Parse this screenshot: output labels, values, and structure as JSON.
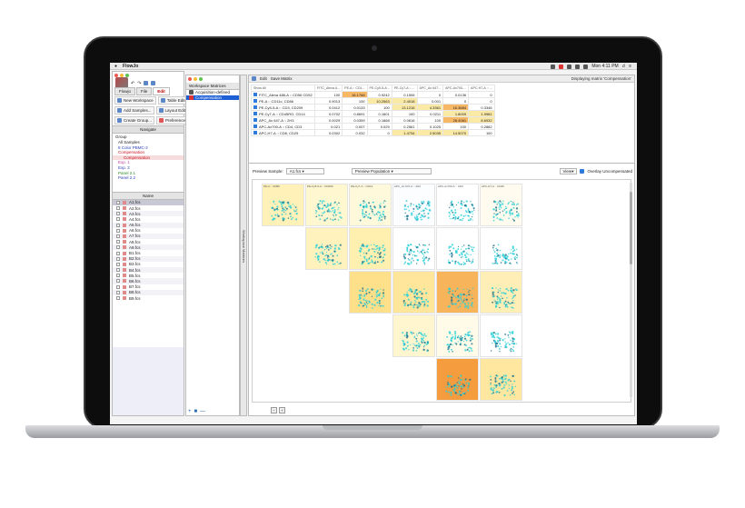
{
  "menubar": {
    "app_name": "FlowJo",
    "clock": "Mon 4:11 PM"
  },
  "left_panel": {
    "tabs": [
      "Flowjo",
      "File",
      "Edit"
    ],
    "buttons": [
      "New Workspace",
      "Table Editor",
      "Add Samples...",
      "Layout Editor",
      "Create Group...",
      "Preferences"
    ],
    "navigate_label": "Navigate",
    "group_header": "Group",
    "groups": [
      {
        "label": "All Samples",
        "style": "normal"
      },
      {
        "label": "8 Color PBMC-2",
        "style": "blue"
      },
      {
        "label": "Compensation",
        "style": "red"
      },
      {
        "label": "Compensation",
        "style": "red-sel"
      },
      {
        "label": "Exp. 1",
        "style": "pink"
      },
      {
        "label": "Exp. 2",
        "style": "blue"
      },
      {
        "label": "Panel 2.1",
        "style": "green"
      },
      {
        "label": "Panel 2.2",
        "style": "blue"
      }
    ],
    "name_header": "Name",
    "samples": [
      "A1.fcs",
      "A2.fcs",
      "A3.fcs",
      "A4.fcs",
      "A5.fcs",
      "A6.fcs",
      "A7.fcs",
      "A8.fcs",
      "A9.fcs",
      "B1.fcs",
      "B2.fcs",
      "B3.fcs",
      "B4.fcs",
      "B5.fcs",
      "B6.fcs",
      "B7.fcs",
      "B8.fcs",
      "B9.fcs"
    ]
  },
  "middle_panel": {
    "title": "Workspace Matrices",
    "items": [
      "Acquisition-defined",
      "Compensation"
    ],
    "vertical_label": "Workspace Matrices"
  },
  "matrix_window": {
    "edit_label": "Edit",
    "save_label": "Save Matrix",
    "displaying": "Displaying matrix 'Compensation'",
    "show_all": "Show All",
    "columns": [
      "FITC_Alexa A...",
      "PE-A :: CD1...",
      "PE-Cy5-5-A...",
      "PE-Cy7-A :: ...",
      "APC_Ax 647...",
      "APC-Ax700-...",
      "APC-H7-A :: ..."
    ],
    "rows": [
      {
        "label": "FITC_Alexa 488-A :: CD56 CD52",
        "values": [
          "100",
          "16.1766",
          "0.9242",
          "0.1506",
          "0",
          "0.0136",
          "0"
        ]
      },
      {
        "label": "PE-A :: CD11c, CD86",
        "values": [
          "0.9013",
          "100",
          "10.2563",
          "2.4018",
          "0.001",
          "0",
          "0"
        ]
      },
      {
        "label": "PE-Cy5-5-A :: CD3, CD209",
        "values": [
          "0.0412",
          "0.0133",
          "100",
          "13.1216",
          "4.3361",
          "16.3684",
          "0.3346"
        ]
      },
      {
        "label": "PE-Cy7-A :: CD45RO, CD14",
        "values": [
          "0.0702",
          "0.8691",
          "0.1601",
          "100",
          "0.0211",
          "1.8009",
          "1.9981"
        ]
      },
      {
        "label": "APC_Ax 647-A :: 2H3",
        "values": [
          "0.0029",
          "0.0359",
          "0.1868",
          "0.0616",
          "100",
          "28.4081",
          "8.6932"
        ]
      },
      {
        "label": "APC-Ax700-A :: CD4, CD3",
        "values": [
          "0.021",
          "0.007",
          "0.029",
          "0.2561",
          "0.1025",
          "100",
          "0.2882"
        ]
      },
      {
        "label": "APC-H7-A :: CD8, CD25",
        "values": [
          "0.0302",
          "0.032",
          "0",
          "1.4734",
          "2.5035",
          "14.5070",
          "100"
        ]
      }
    ],
    "preview_sample_label": "Preview Sample:",
    "preview_sample_value": "A1.fcs",
    "preview_population_value": "Preview Population",
    "view_label": "View",
    "overlay_label": "Overlay Uncompensated",
    "plot_headers": [
      "PE-A :: CD86",
      "PE-Cy5-5-A :: CD209",
      "PE-Cy7-A :: CD14",
      "APC_Ax 647-A :: 2H3",
      "APC-Ax700-A :: CD3",
      "APC-H7-A :: CD25"
    ],
    "row_labels": [
      "FITC",
      "PE-A",
      "PE-Cy5-5-A",
      "PE-Cy7-A",
      "APC_Ax 647-A",
      "APC-Ax700-A"
    ]
  },
  "colors": {
    "highlight_yellow": "#fbe9a6",
    "highlight_orange": "#f7b866",
    "selection_blue": "#1f5fd6",
    "dots_cyan": "#28d0d8"
  }
}
